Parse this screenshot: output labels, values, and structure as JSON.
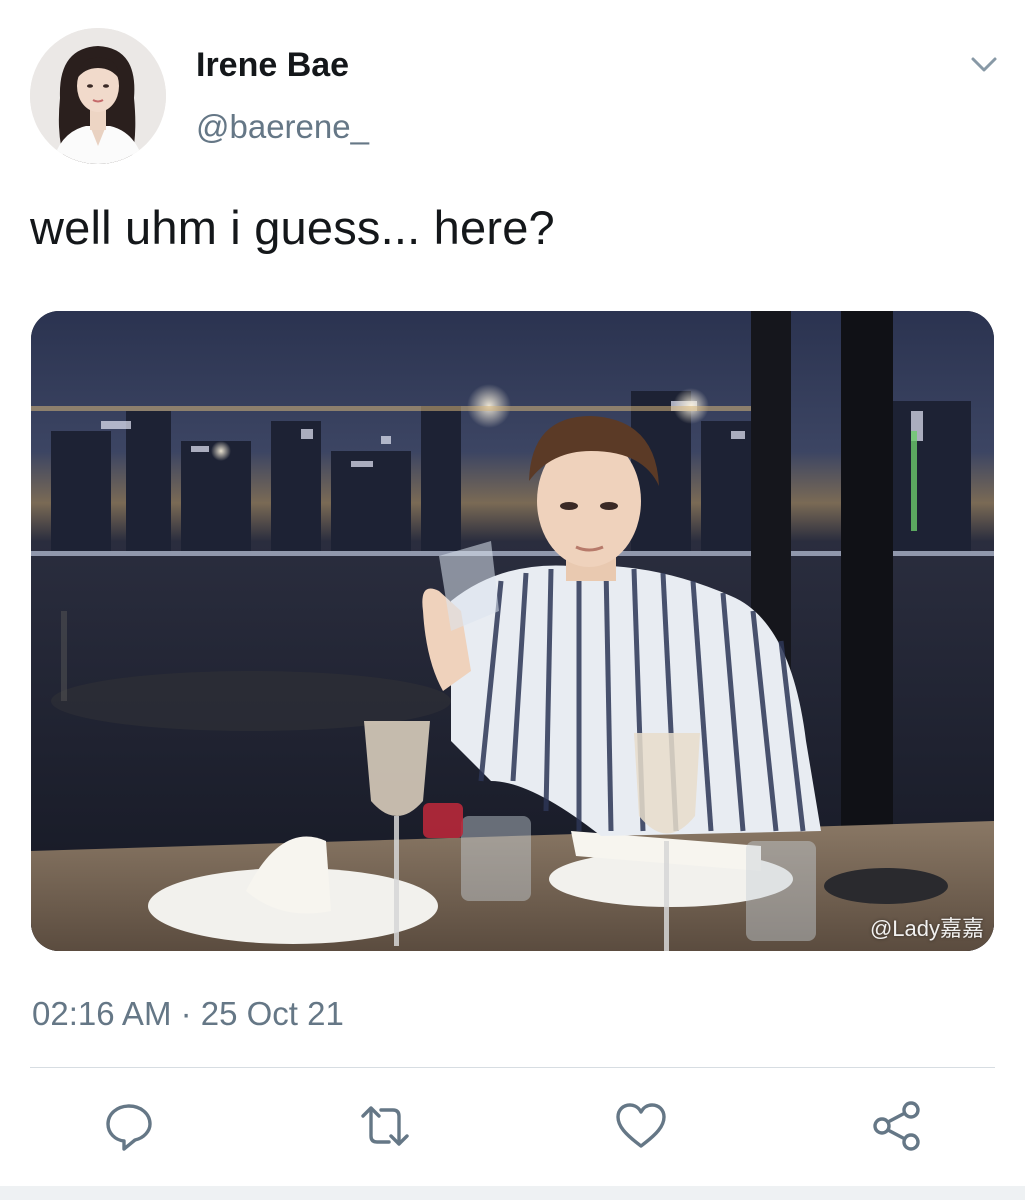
{
  "tweet": {
    "author": {
      "name": "Irene Bae",
      "handle": "@baerene_"
    },
    "text": "well uhm i guess... here?",
    "media": {
      "watermark": "@Lady嘉嘉"
    },
    "timestamp": "02:16 AM · 25 Oct 21"
  },
  "icons": {
    "more": "chevron-down-icon",
    "reply": "reply-icon",
    "retweet": "retweet-icon",
    "like": "heart-icon",
    "share": "share-icon"
  },
  "colors": {
    "text_primary": "#14171a",
    "text_secondary": "#657786",
    "icon": "#657786",
    "divider": "#d7dde2"
  }
}
